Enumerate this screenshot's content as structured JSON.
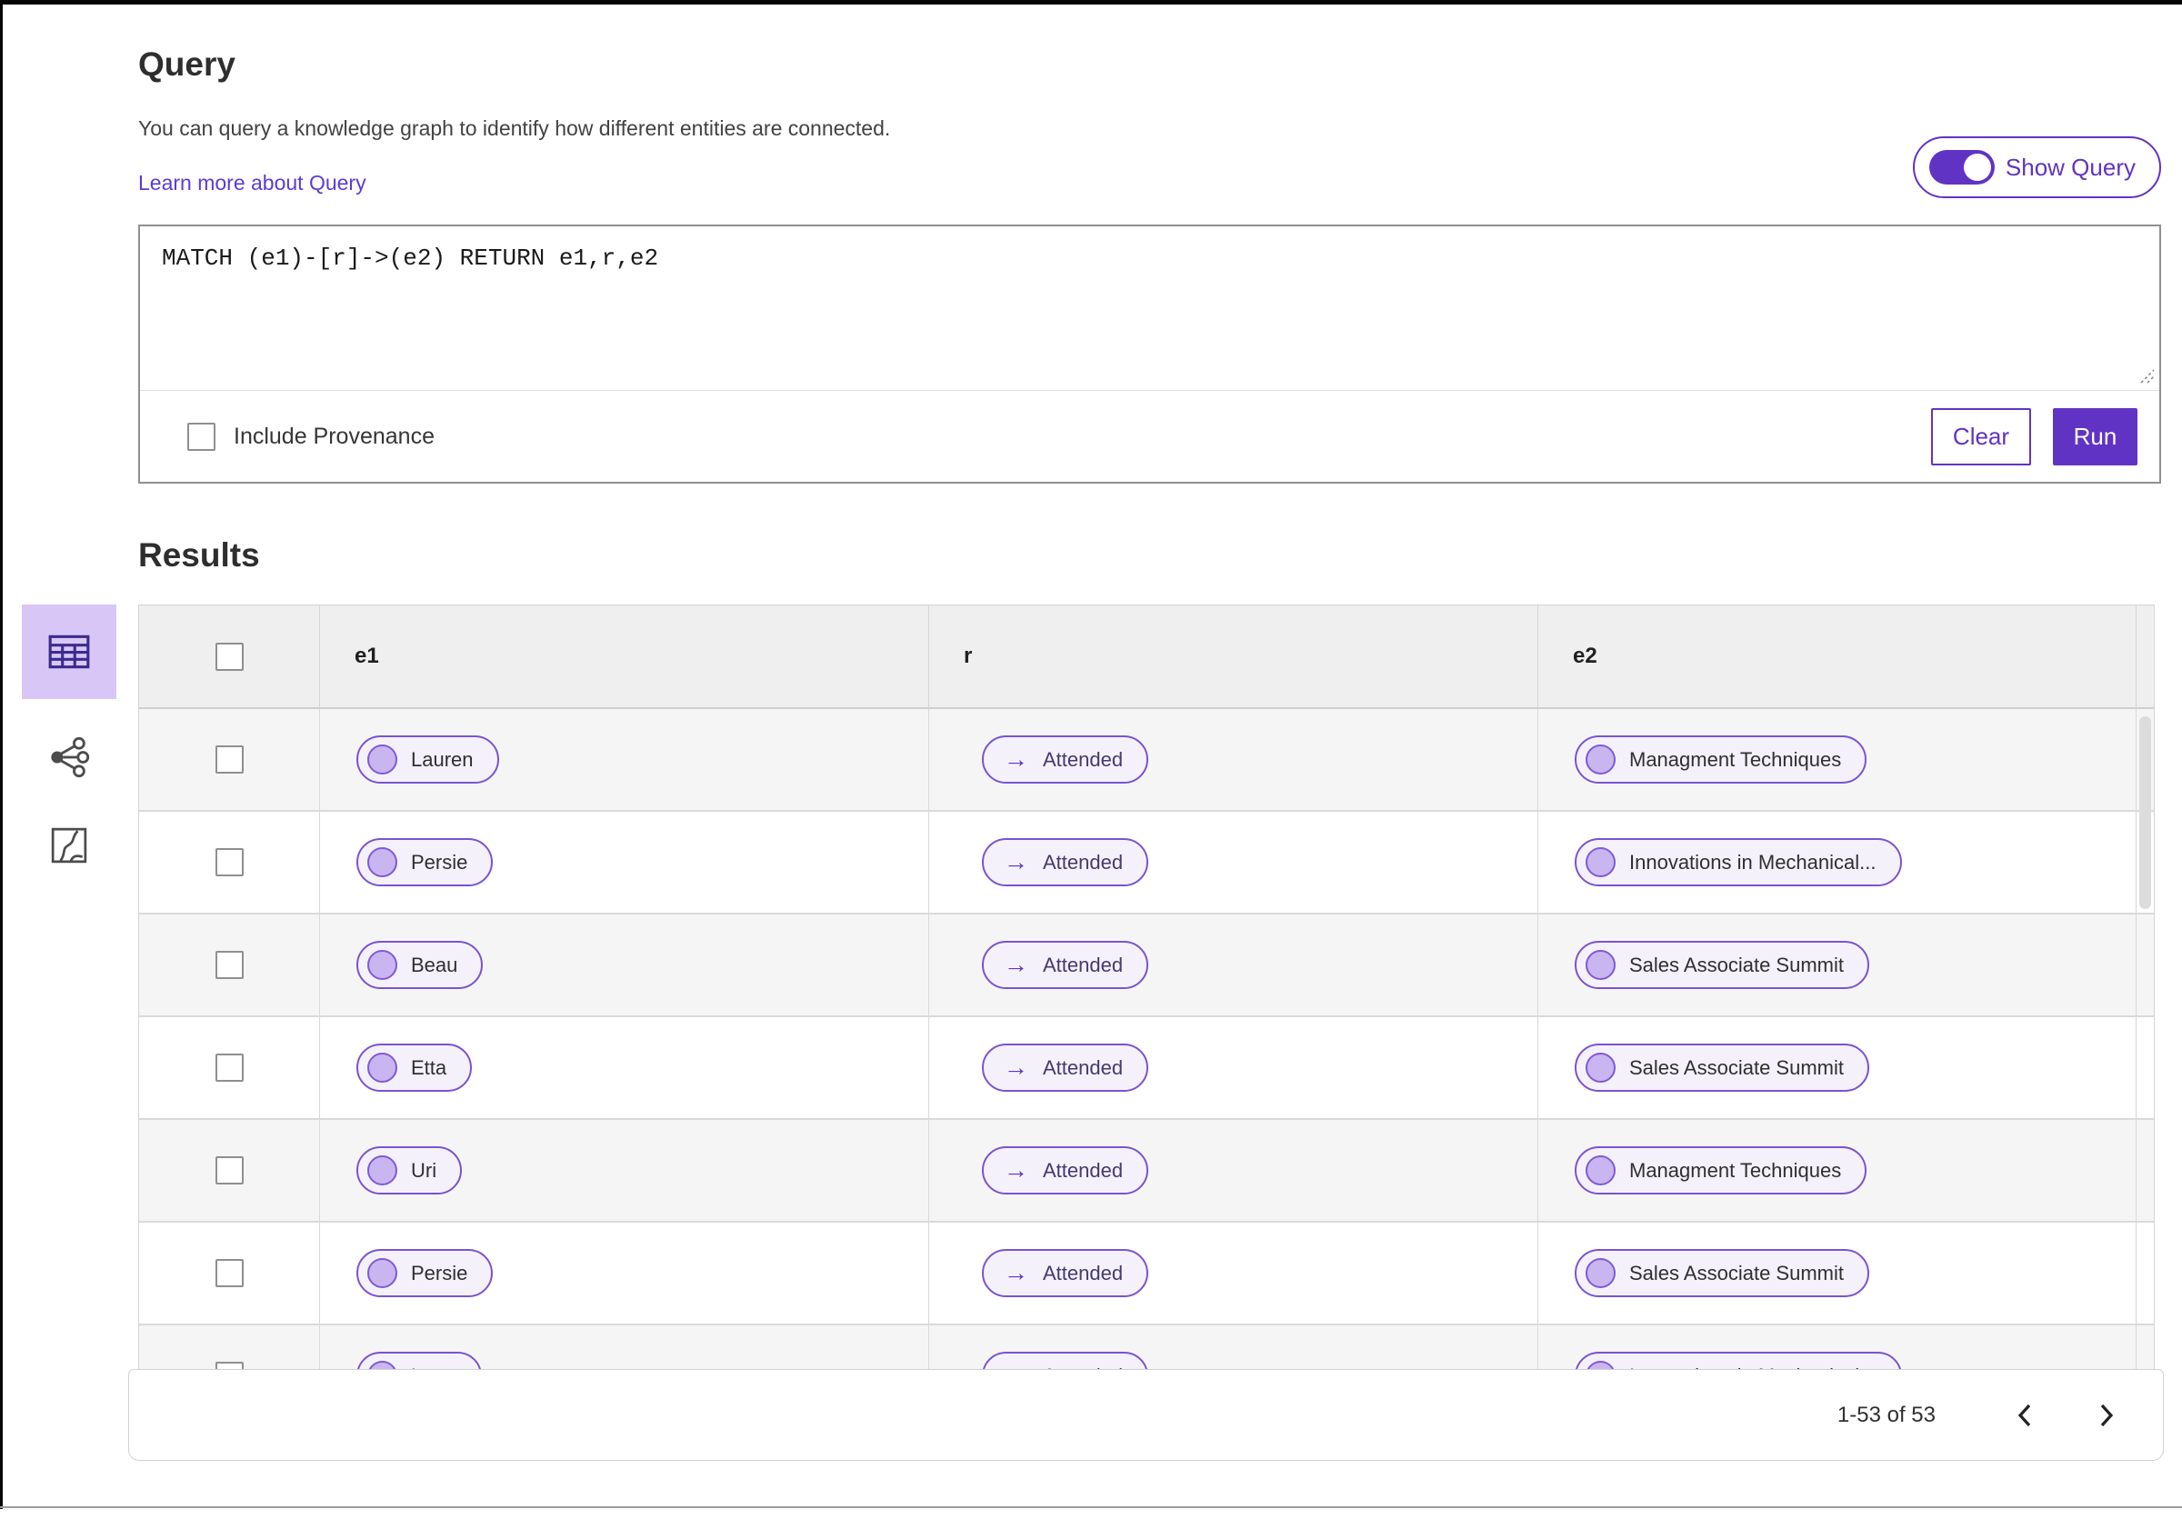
{
  "colors": {
    "accent": "#6133c4",
    "pill_border": "#7a53d1",
    "selected_view_bg": "#d8c7f6",
    "header_row_bg": "#efefef",
    "alt_row_bg": "#f5f5f5"
  },
  "header": {
    "title": "Query",
    "description": "You can query a knowledge graph to identify how different entities are connected.",
    "learn_more": "Learn more about Query",
    "show_query_label": "Show Query",
    "show_query_state": "on"
  },
  "query_editor": {
    "query_text": "MATCH (e1)-[r]->(e2) RETURN e1,r,e2",
    "include_provenance_label": "Include Provenance",
    "include_provenance_checked": false,
    "clear_label": "Clear",
    "run_label": "Run"
  },
  "results": {
    "title": "Results",
    "view_icons": [
      "table-view-icon",
      "graph-view-icon",
      "map-view-icon"
    ],
    "selected_view": "table-view",
    "columns": [
      "e1",
      "r",
      "e2"
    ],
    "rows": [
      {
        "e1": "Lauren",
        "r": "Attended",
        "e2": "Managment Techniques"
      },
      {
        "e1": "Persie",
        "r": "Attended",
        "e2": "Innovations in Mechanical..."
      },
      {
        "e1": "Beau",
        "r": "Attended",
        "e2": "Sales Associate Summit"
      },
      {
        "e1": "Etta",
        "r": "Attended",
        "e2": "Sales Associate Summit"
      },
      {
        "e1": "Uri",
        "r": "Attended",
        "e2": "Managment Techniques"
      },
      {
        "e1": "Persie",
        "r": "Attended",
        "e2": "Sales Associate Summit"
      },
      {
        "e1": "Larry",
        "r": "Attended",
        "e2": "Innovations in Mechanical..."
      }
    ],
    "pagination": {
      "label": "1-53 of 53"
    }
  }
}
